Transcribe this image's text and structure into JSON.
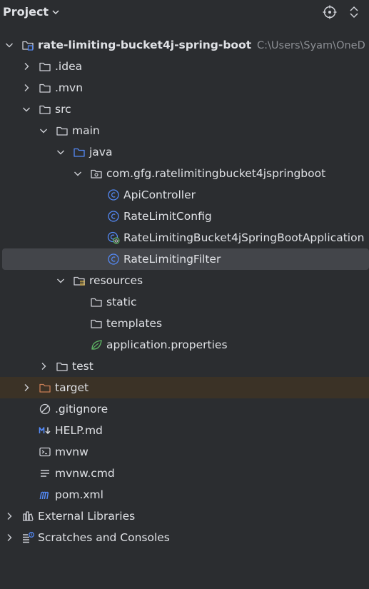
{
  "header": {
    "title": "Project",
    "title_icon": "chevron-down-icon",
    "locate_icon": "crosshair-icon",
    "expand_collapse_icon": "expand-collapse-icon"
  },
  "tree": [
    {
      "label": "rate-limiting-bucket4j-spring-boot",
      "path": "C:\\Users\\Syam\\OneD",
      "icon": "module-folder-icon",
      "expanded": true
    },
    {
      "label": ".idea",
      "icon": "folder-icon",
      "expanded": false
    },
    {
      "label": ".mvn",
      "icon": "folder-icon",
      "expanded": false
    },
    {
      "label": "src",
      "icon": "folder-icon",
      "expanded": true
    },
    {
      "label": "main",
      "icon": "folder-icon",
      "expanded": true
    },
    {
      "label": "java",
      "icon": "source-folder-icon",
      "expanded": true
    },
    {
      "label": "com.gfg.ratelimitingbucket4jspringboot",
      "icon": "package-icon",
      "expanded": true
    },
    {
      "label": "ApiController",
      "icon": "java-class-icon"
    },
    {
      "label": "RateLimitConfig",
      "icon": "java-class-icon"
    },
    {
      "label": "RateLimitingBucket4jSpringBootApplication",
      "icon": "spring-boot-app-icon"
    },
    {
      "label": "RateLimitingFilter",
      "icon": "java-class-icon",
      "selected": true
    },
    {
      "label": "resources",
      "icon": "resources-folder-icon",
      "expanded": true
    },
    {
      "label": "static",
      "icon": "folder-icon"
    },
    {
      "label": "templates",
      "icon": "folder-icon"
    },
    {
      "label": "application.properties",
      "icon": "spring-properties-icon"
    },
    {
      "label": "test",
      "icon": "folder-icon",
      "expanded": false
    },
    {
      "label": "target",
      "icon": "excluded-folder-icon",
      "expanded": false
    },
    {
      "label": ".gitignore",
      "icon": "ignore-file-icon"
    },
    {
      "label": "HELP.md",
      "icon": "markdown-icon"
    },
    {
      "label": "mvnw",
      "icon": "terminal-icon"
    },
    {
      "label": "mvnw.cmd",
      "icon": "text-file-icon"
    },
    {
      "label": "pom.xml",
      "icon": "maven-icon"
    },
    {
      "label": "External Libraries",
      "icon": "libraries-icon",
      "expanded": false
    },
    {
      "label": "Scratches and Consoles",
      "icon": "scratches-icon",
      "expanded": false
    }
  ],
  "colors": {
    "background": "#2b2d30",
    "selection": "#43454a",
    "excluded_row": "#3b3226",
    "java_class": "#548af7",
    "target_folder": "#c77d55",
    "spring_green": "#5fb865"
  }
}
